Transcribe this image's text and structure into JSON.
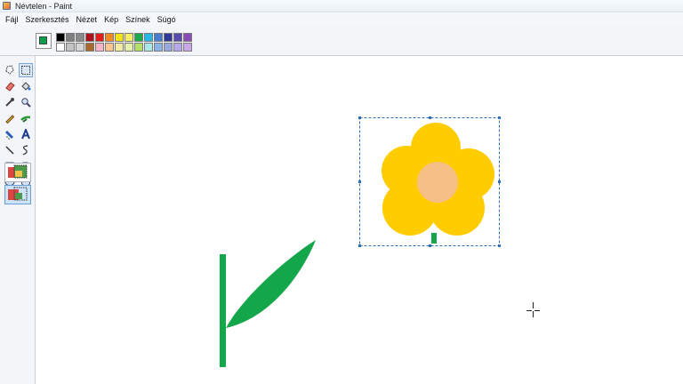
{
  "window": {
    "title": "Névtelen - Paint"
  },
  "menu": [
    "Fájl",
    "Szerkesztés",
    "Nézet",
    "Kép",
    "Színek",
    "Súgó"
  ],
  "colors": {
    "foreground": "#0aa04a",
    "palette": [
      "#000000",
      "#7f7f7f",
      "#8a8a8a",
      "#b0121b",
      "#e3201b",
      "#f38a1d",
      "#f5e215",
      "#f5ee5e",
      "#1fa84a",
      "#23b8e8",
      "#4b7bd0",
      "#2d3a9c",
      "#5a4ab0",
      "#8a4ab8",
      "#ffffff",
      "#c3c3c3",
      "#d7d7d7",
      "#a9692a",
      "#f8b5c8",
      "#fbc78e",
      "#f3eaa3",
      "#e6f0a8",
      "#b4e06a",
      "#a8e8e8",
      "#8ab4e8",
      "#9aa8e0",
      "#b6a8e8",
      "#c8a8e8"
    ]
  },
  "toolbox": {
    "icons": [
      "free-form-select-icon",
      "rectangle-select-icon",
      "eraser-icon",
      "fill-bucket-icon",
      "color-picker-icon",
      "magnifier-icon",
      "pencil-icon",
      "brush-icon",
      "airbrush-icon",
      "text-icon",
      "line-icon",
      "curve-icon",
      "rectangle-icon",
      "polygon-icon",
      "ellipse-icon",
      "rounded-rectangle-icon"
    ],
    "options": [
      "opaque-selection-option",
      "transparent-selection-option"
    ]
  },
  "drawing": {
    "petal_color": "#ffcc00",
    "center_color": "#f5bf86",
    "stem_color": "#13a64a",
    "selection_color": "#2f6fb8"
  }
}
